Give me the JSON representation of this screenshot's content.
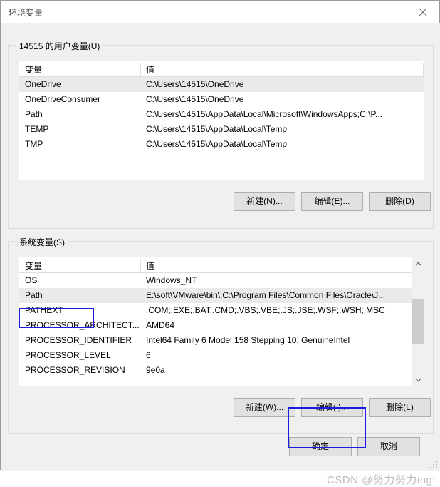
{
  "window": {
    "title": "环境变量",
    "close_icon": "close-icon"
  },
  "user_section": {
    "legend": "14515 的用户变量(U)",
    "columns": [
      "变量",
      "值"
    ],
    "rows": [
      {
        "name": "OneDrive",
        "value": "C:\\Users\\14515\\OneDrive",
        "selected": true
      },
      {
        "name": "OneDriveConsumer",
        "value": "C:\\Users\\14515\\OneDrive",
        "selected": false
      },
      {
        "name": "Path",
        "value": "C:\\Users\\14515\\AppData\\Local\\Microsoft\\WindowsApps;C:\\P...",
        "selected": false
      },
      {
        "name": "TEMP",
        "value": "C:\\Users\\14515\\AppData\\Local\\Temp",
        "selected": false
      },
      {
        "name": "TMP",
        "value": "C:\\Users\\14515\\AppData\\Local\\Temp",
        "selected": false
      }
    ],
    "buttons": {
      "new": "新建(N)...",
      "edit": "编辑(E)...",
      "delete": "删除(D)"
    }
  },
  "system_section": {
    "legend": "系统变量(S)",
    "columns": [
      "变量",
      "值"
    ],
    "rows": [
      {
        "name": "OS",
        "value": "Windows_NT",
        "selected": false
      },
      {
        "name": "Path",
        "value": "E:\\soft\\VMware\\bin\\;C:\\Program Files\\Common Files\\Oracle\\J...",
        "selected": true
      },
      {
        "name": "PATHEXT",
        "value": ".COM;.EXE;.BAT;.CMD;.VBS;.VBE;.JS;.JSE;.WSF;.WSH;.MSC",
        "selected": false
      },
      {
        "name": "PROCESSOR_ARCHITECT...",
        "value": "AMD64",
        "selected": false
      },
      {
        "name": "PROCESSOR_IDENTIFIER",
        "value": "Intel64 Family 6 Model 158 Stepping 10, GenuineIntel",
        "selected": false
      },
      {
        "name": "PROCESSOR_LEVEL",
        "value": "6",
        "selected": false
      },
      {
        "name": "PROCESSOR_REVISION",
        "value": "9e0a",
        "selected": false
      }
    ],
    "buttons": {
      "new": "新建(W)...",
      "edit": "编辑(I)...",
      "delete": "删除(L)"
    },
    "scrollbar": {
      "up_icon": "chevron-up-icon",
      "down_icon": "chevron-down-icon"
    }
  },
  "footer": {
    "ok": "确定",
    "cancel": "取消"
  },
  "annotations": {
    "color": "#1a1ae6",
    "highlight_path_row": "Path",
    "highlight_edit_button": "编辑(I)..."
  },
  "watermark": {
    "text": "CSDN @努力努力ing!"
  }
}
